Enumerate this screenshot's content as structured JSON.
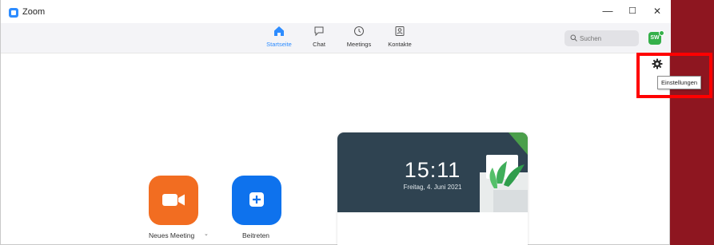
{
  "window": {
    "title": "Zoom",
    "minimize": "—",
    "maximize": "☐",
    "close": "✕"
  },
  "nav": {
    "tabs": [
      {
        "label": "Startseite",
        "icon": "home-icon",
        "active": true
      },
      {
        "label": "Chat",
        "icon": "chat-icon",
        "active": false
      },
      {
        "label": "Meetings",
        "icon": "clock-icon",
        "active": false
      },
      {
        "label": "Kontakte",
        "icon": "contacts-icon",
        "active": false
      }
    ],
    "search_placeholder": "Suchen",
    "avatar_initials": "SW"
  },
  "settings": {
    "icon": "gear-icon",
    "tooltip": "Einstellungen"
  },
  "actions": {
    "new_meeting": {
      "label": "Neues Meeting",
      "icon": "video-camera-icon",
      "color": "#f26d21"
    },
    "join": {
      "label": "Beitreten",
      "icon": "plus-icon",
      "color": "#0e72ed"
    }
  },
  "clock_card": {
    "time": "15:11",
    "date": "Freitag, 4. Juni 2021"
  },
  "colors": {
    "accent": "#2d8cff",
    "highlight": "#ff0000",
    "backdrop": "#8e1620"
  }
}
